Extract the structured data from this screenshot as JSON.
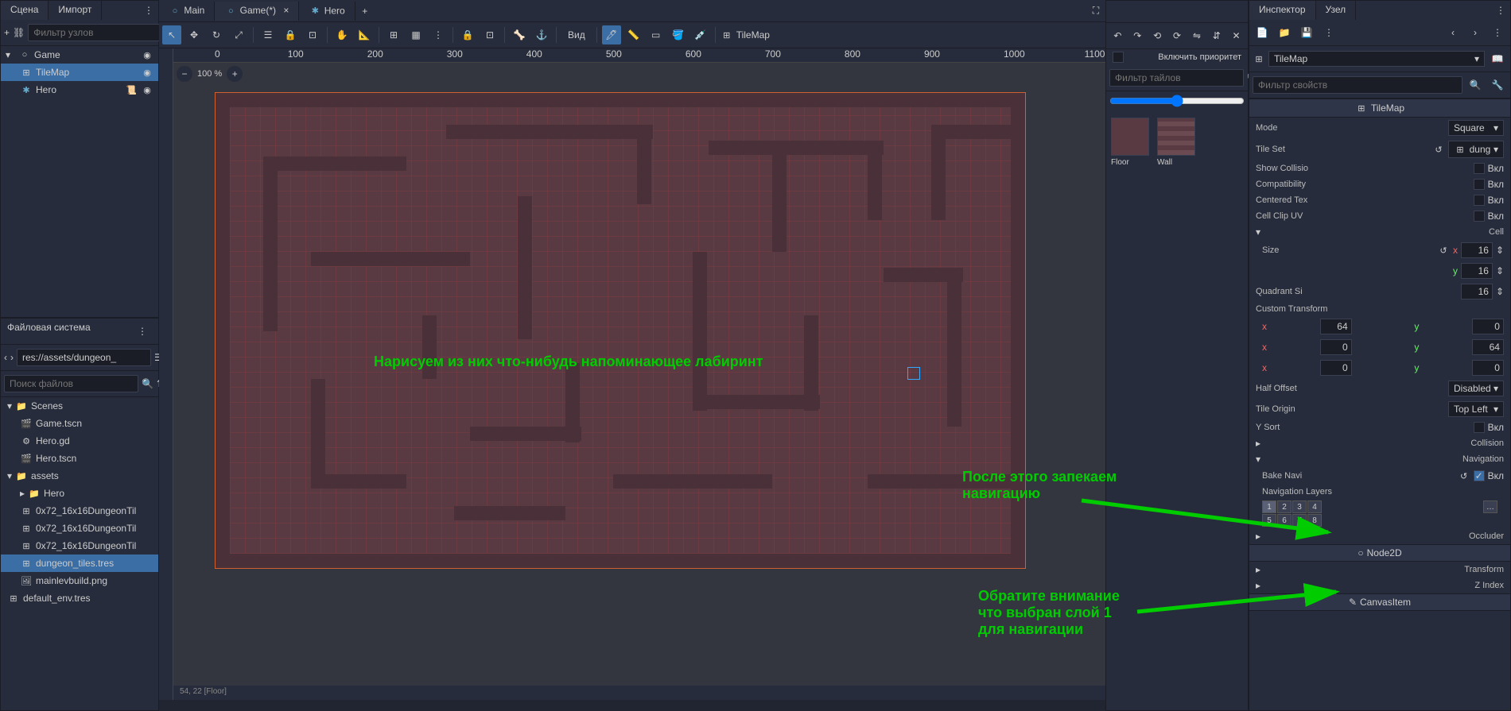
{
  "left": {
    "tabs": {
      "scene": "Сцена",
      "import": "Импорт"
    },
    "toolbar": {
      "filter_placeholder": "Фильтр узлов"
    },
    "tree": [
      {
        "name": "Game",
        "icon": "○",
        "indent": 0,
        "vis": true
      },
      {
        "name": "TileMap",
        "icon": "⊞",
        "indent": 1,
        "selected": true,
        "vis": true
      },
      {
        "name": "Hero",
        "icon": "✱",
        "indent": 1,
        "script": true
      }
    ],
    "fs": {
      "title": "Файловая система",
      "path": "res://assets/dungeon_",
      "search_placeholder": "Поиск файлов",
      "items": [
        {
          "name": "Scenes",
          "type": "folder",
          "indent": 0,
          "open": true
        },
        {
          "name": "Game.tscn",
          "type": "scene",
          "indent": 1
        },
        {
          "name": "Hero.gd",
          "type": "script",
          "indent": 1
        },
        {
          "name": "Hero.tscn",
          "type": "scene",
          "indent": 1
        },
        {
          "name": "assets",
          "type": "folder",
          "indent": 0,
          "open": true
        },
        {
          "name": "Hero",
          "type": "folder",
          "indent": 1
        },
        {
          "name": "0x72_16x16DungeonTil",
          "type": "res",
          "indent": 1
        },
        {
          "name": "0x72_16x16DungeonTil",
          "type": "res",
          "indent": 1
        },
        {
          "name": "0x72_16x16DungeonTil",
          "type": "res",
          "indent": 1
        },
        {
          "name": "dungeon_tiles.tres",
          "type": "res",
          "indent": 1,
          "selected": true
        },
        {
          "name": "mainlevbuild.png",
          "type": "img",
          "indent": 1
        },
        {
          "name": "default_env.tres",
          "type": "res",
          "indent": 0
        }
      ]
    }
  },
  "center": {
    "tabs": [
      {
        "name": "Main",
        "icon": "○"
      },
      {
        "name": "Game(*)",
        "icon": "○",
        "active": true
      },
      {
        "name": "Hero",
        "icon": "✱"
      }
    ],
    "view_label": "Вид",
    "tilemap_label": "TileMap",
    "zoom": "100 %",
    "status": "54, 22 [Floor]"
  },
  "tilepanel": {
    "priority_label": "Включить приоритет",
    "filter_placeholder": "Фильтр тайлов",
    "tiles": [
      {
        "name": "Floor",
        "color": "#5a3a42"
      },
      {
        "name": "Wall",
        "color": "#6b4a52"
      }
    ]
  },
  "inspector": {
    "tabs": {
      "inspector": "Инспектор",
      "node": "Узел"
    },
    "object": "TileMap",
    "filter_placeholder": "Фильтр свойств",
    "section_header": "TileMap",
    "props": {
      "mode": {
        "label": "Mode",
        "value": "Square"
      },
      "tileset": {
        "label": "Tile Set",
        "value": "dung"
      },
      "show_collision": {
        "label": "Show Collisio",
        "value": "Вкл"
      },
      "compatibility": {
        "label": "Compatibility",
        "value": "Вкл"
      },
      "centered_tex": {
        "label": "Centered Tex",
        "value": "Вкл"
      },
      "cell_clip_uv": {
        "label": "Cell Clip UV",
        "value": "Вкл"
      },
      "cell": "Cell",
      "size": {
        "label": "Size",
        "x": "16",
        "y": "16"
      },
      "quadrant": {
        "label": "Quadrant Si",
        "value": "16"
      },
      "custom_transform": "Custom Transform",
      "ct": [
        [
          "64",
          "0"
        ],
        [
          "0",
          "64"
        ],
        [
          "0",
          "0"
        ]
      ],
      "half_offset": {
        "label": "Half Offset",
        "value": "Disabled"
      },
      "tile_origin": {
        "label": "Tile Origin",
        "value": "Top Left"
      },
      "y_sort": {
        "label": "Y Sort",
        "value": "Вкл"
      },
      "collision": "Collision",
      "navigation": "Navigation",
      "bake_navi": {
        "label": "Bake Navi",
        "value": "Вкл",
        "on": true
      },
      "nav_layers": "Navigation Layers",
      "occluder": "Occluder",
      "node2d": "Node2D",
      "transform": "Transform",
      "z_index": "Z Index",
      "canvasitem": "CanvasItem"
    }
  },
  "annotations": {
    "a1": "Нарисуем из них что-нибудь напоминающее лабиринт",
    "a2": "После этого запекаем\nнавигацию",
    "a3": "Обратите внимание\nчто выбран слой 1\nдля навигации"
  }
}
